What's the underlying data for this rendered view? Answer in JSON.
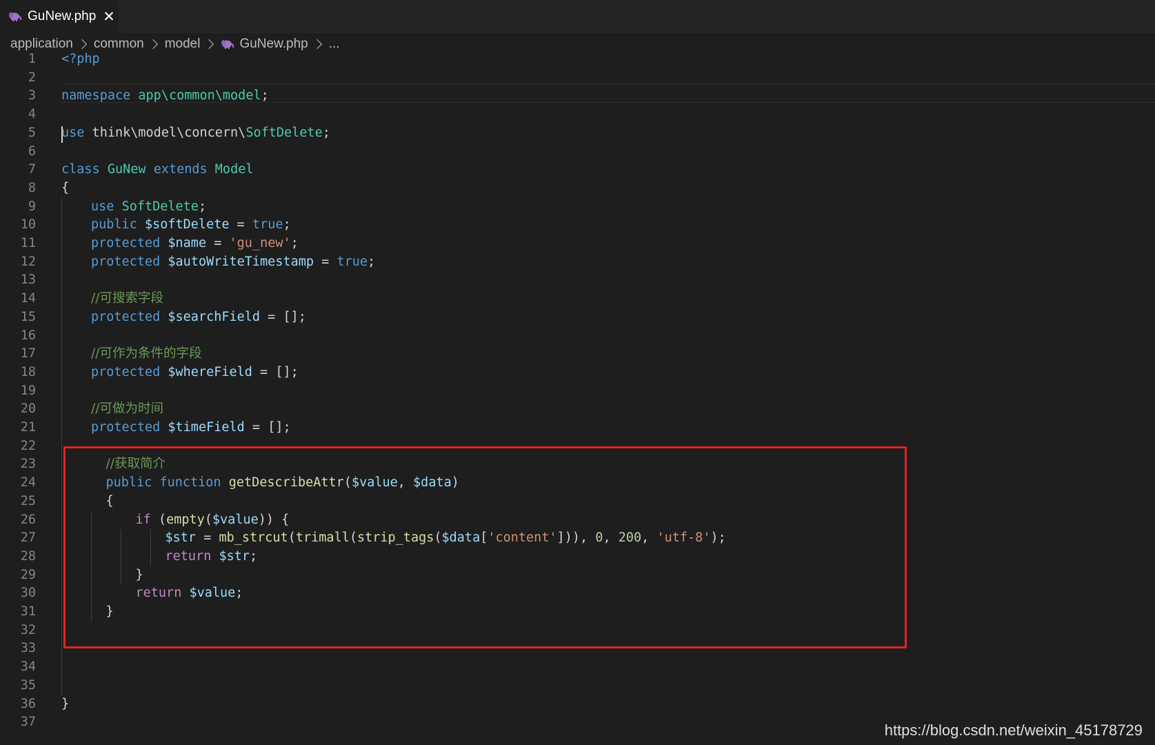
{
  "tab": {
    "label": "GuNew.php",
    "close": "✕"
  },
  "breadcrumb": {
    "items": [
      "application",
      "common",
      "model",
      "GuNew.php",
      "..."
    ]
  },
  "editor": {
    "lines": [
      {
        "n": "1",
        "indent": 0,
        "tokens": [
          [
            "kw",
            "<?php"
          ]
        ]
      },
      {
        "n": "2",
        "indent": 0,
        "tokens": []
      },
      {
        "n": "3",
        "indent": 0,
        "tokens": [
          [
            "kw",
            "namespace"
          ],
          [
            "p",
            " "
          ],
          [
            "cls",
            "app\\common\\model"
          ],
          [
            "p",
            ";"
          ]
        ]
      },
      {
        "n": "4",
        "indent": 0,
        "tokens": []
      },
      {
        "n": "5",
        "indent": 0,
        "tokens": [
          [
            "kw",
            "use"
          ],
          [
            "p",
            " think\\model\\concern\\"
          ],
          [
            "cls",
            "SoftDelete"
          ],
          [
            "p",
            ";"
          ]
        ]
      },
      {
        "n": "6",
        "indent": 0,
        "tokens": []
      },
      {
        "n": "7",
        "indent": 0,
        "tokens": [
          [
            "kw",
            "class"
          ],
          [
            "p",
            " "
          ],
          [
            "cls",
            "GuNew"
          ],
          [
            "p",
            " "
          ],
          [
            "kw",
            "extends"
          ],
          [
            "p",
            " "
          ],
          [
            "cls",
            "Model"
          ]
        ]
      },
      {
        "n": "8",
        "indent": 0,
        "tokens": [
          [
            "p",
            "{"
          ]
        ]
      },
      {
        "n": "9",
        "indent": 1,
        "tokens": [
          [
            "kw",
            "use"
          ],
          [
            "p",
            " "
          ],
          [
            "cls",
            "SoftDelete"
          ],
          [
            "p",
            ";"
          ]
        ]
      },
      {
        "n": "10",
        "indent": 1,
        "tokens": [
          [
            "kw",
            "public"
          ],
          [
            "p",
            " "
          ],
          [
            "var",
            "$softDelete"
          ],
          [
            "p",
            " = "
          ],
          [
            "kw",
            "true"
          ],
          [
            "p",
            ";"
          ]
        ]
      },
      {
        "n": "11",
        "indent": 1,
        "tokens": [
          [
            "kw",
            "protected"
          ],
          [
            "p",
            " "
          ],
          [
            "var",
            "$name"
          ],
          [
            "p",
            " = "
          ],
          [
            "str",
            "'gu_new'"
          ],
          [
            "p",
            ";"
          ]
        ]
      },
      {
        "n": "12",
        "indent": 1,
        "tokens": [
          [
            "kw",
            "protected"
          ],
          [
            "p",
            " "
          ],
          [
            "var",
            "$autoWriteTimestamp"
          ],
          [
            "p",
            " = "
          ],
          [
            "kw",
            "true"
          ],
          [
            "p",
            ";"
          ]
        ]
      },
      {
        "n": "13",
        "indent": 0,
        "tokens": []
      },
      {
        "n": "14",
        "indent": 1,
        "tokens": [
          [
            "cm",
            "//可搜索字段"
          ]
        ]
      },
      {
        "n": "15",
        "indent": 1,
        "tokens": [
          [
            "kw",
            "protected"
          ],
          [
            "p",
            " "
          ],
          [
            "var",
            "$searchField"
          ],
          [
            "p",
            " = [];"
          ]
        ]
      },
      {
        "n": "16",
        "indent": 0,
        "tokens": []
      },
      {
        "n": "17",
        "indent": 1,
        "tokens": [
          [
            "cm",
            "//可作为条件的字段"
          ]
        ]
      },
      {
        "n": "18",
        "indent": 1,
        "tokens": [
          [
            "kw",
            "protected"
          ],
          [
            "p",
            " "
          ],
          [
            "var",
            "$whereField"
          ],
          [
            "p",
            " = [];"
          ]
        ]
      },
      {
        "n": "19",
        "indent": 0,
        "tokens": []
      },
      {
        "n": "20",
        "indent": 1,
        "tokens": [
          [
            "cm",
            "//可做为时间"
          ]
        ]
      },
      {
        "n": "21",
        "indent": 1,
        "tokens": [
          [
            "kw",
            "protected"
          ],
          [
            "p",
            " "
          ],
          [
            "var",
            "$timeField"
          ],
          [
            "p",
            " = [];"
          ]
        ]
      },
      {
        "n": "22",
        "indent": 0,
        "tokens": []
      },
      {
        "n": "23",
        "indent": 1.5,
        "tokens": [
          [
            "cm",
            "//获取简介"
          ]
        ]
      },
      {
        "n": "24",
        "indent": 1.5,
        "tokens": [
          [
            "kw",
            "public"
          ],
          [
            "p",
            " "
          ],
          [
            "kw",
            "function"
          ],
          [
            "p",
            " "
          ],
          [
            "fn",
            "getDescribeAttr"
          ],
          [
            "p",
            "("
          ],
          [
            "var",
            "$value"
          ],
          [
            "p",
            ", "
          ],
          [
            "var",
            "$data"
          ],
          [
            "p",
            ")"
          ]
        ]
      },
      {
        "n": "25",
        "indent": 1.5,
        "tokens": [
          [
            "p",
            "{"
          ]
        ]
      },
      {
        "n": "26",
        "indent": 2.5,
        "tokens": [
          [
            "ctl",
            "if"
          ],
          [
            "p",
            " ("
          ],
          [
            "fn",
            "empty"
          ],
          [
            "p",
            "("
          ],
          [
            "var",
            "$value"
          ],
          [
            "p",
            ")) {"
          ]
        ]
      },
      {
        "n": "27",
        "indent": 3.5,
        "tokens": [
          [
            "var",
            "$str"
          ],
          [
            "p",
            " = "
          ],
          [
            "fn",
            "mb_strcut"
          ],
          [
            "p",
            "("
          ],
          [
            "fn",
            "trimall"
          ],
          [
            "p",
            "("
          ],
          [
            "fn",
            "strip_tags"
          ],
          [
            "p",
            "("
          ],
          [
            "var",
            "$data"
          ],
          [
            "p",
            "["
          ],
          [
            "str",
            "'content'"
          ],
          [
            "p",
            "])), "
          ],
          [
            "num",
            "0"
          ],
          [
            "p",
            ", "
          ],
          [
            "num",
            "200"
          ],
          [
            "p",
            ", "
          ],
          [
            "str",
            "'utf-8'"
          ],
          [
            "p",
            ");"
          ]
        ]
      },
      {
        "n": "28",
        "indent": 3.5,
        "tokens": [
          [
            "ctl",
            "return"
          ],
          [
            "p",
            " "
          ],
          [
            "var",
            "$str"
          ],
          [
            "p",
            ";"
          ]
        ]
      },
      {
        "n": "29",
        "indent": 2.5,
        "tokens": [
          [
            "p",
            "}"
          ]
        ]
      },
      {
        "n": "30",
        "indent": 2.5,
        "tokens": [
          [
            "ctl",
            "return"
          ],
          [
            "p",
            " "
          ],
          [
            "var",
            "$value"
          ],
          [
            "p",
            ";"
          ]
        ]
      },
      {
        "n": "31",
        "indent": 1.5,
        "tokens": [
          [
            "p",
            "}"
          ]
        ]
      },
      {
        "n": "32",
        "indent": 0,
        "tokens": []
      },
      {
        "n": "33",
        "indent": 0,
        "tokens": []
      },
      {
        "n": "34",
        "indent": 0,
        "tokens": []
      },
      {
        "n": "35",
        "indent": 0,
        "tokens": []
      },
      {
        "n": "36",
        "indent": 0,
        "tokens": [
          [
            "p",
            "}"
          ]
        ]
      },
      {
        "n": "37",
        "indent": 0,
        "tokens": []
      }
    ]
  },
  "watermark": "https://blog.csdn.net/weixin_45178729",
  "colors": {
    "keyword": "#569cd6",
    "class": "#4ec9b0",
    "string": "#ce9178",
    "comment": "#6a9955",
    "highlight_box": "#e02424"
  }
}
